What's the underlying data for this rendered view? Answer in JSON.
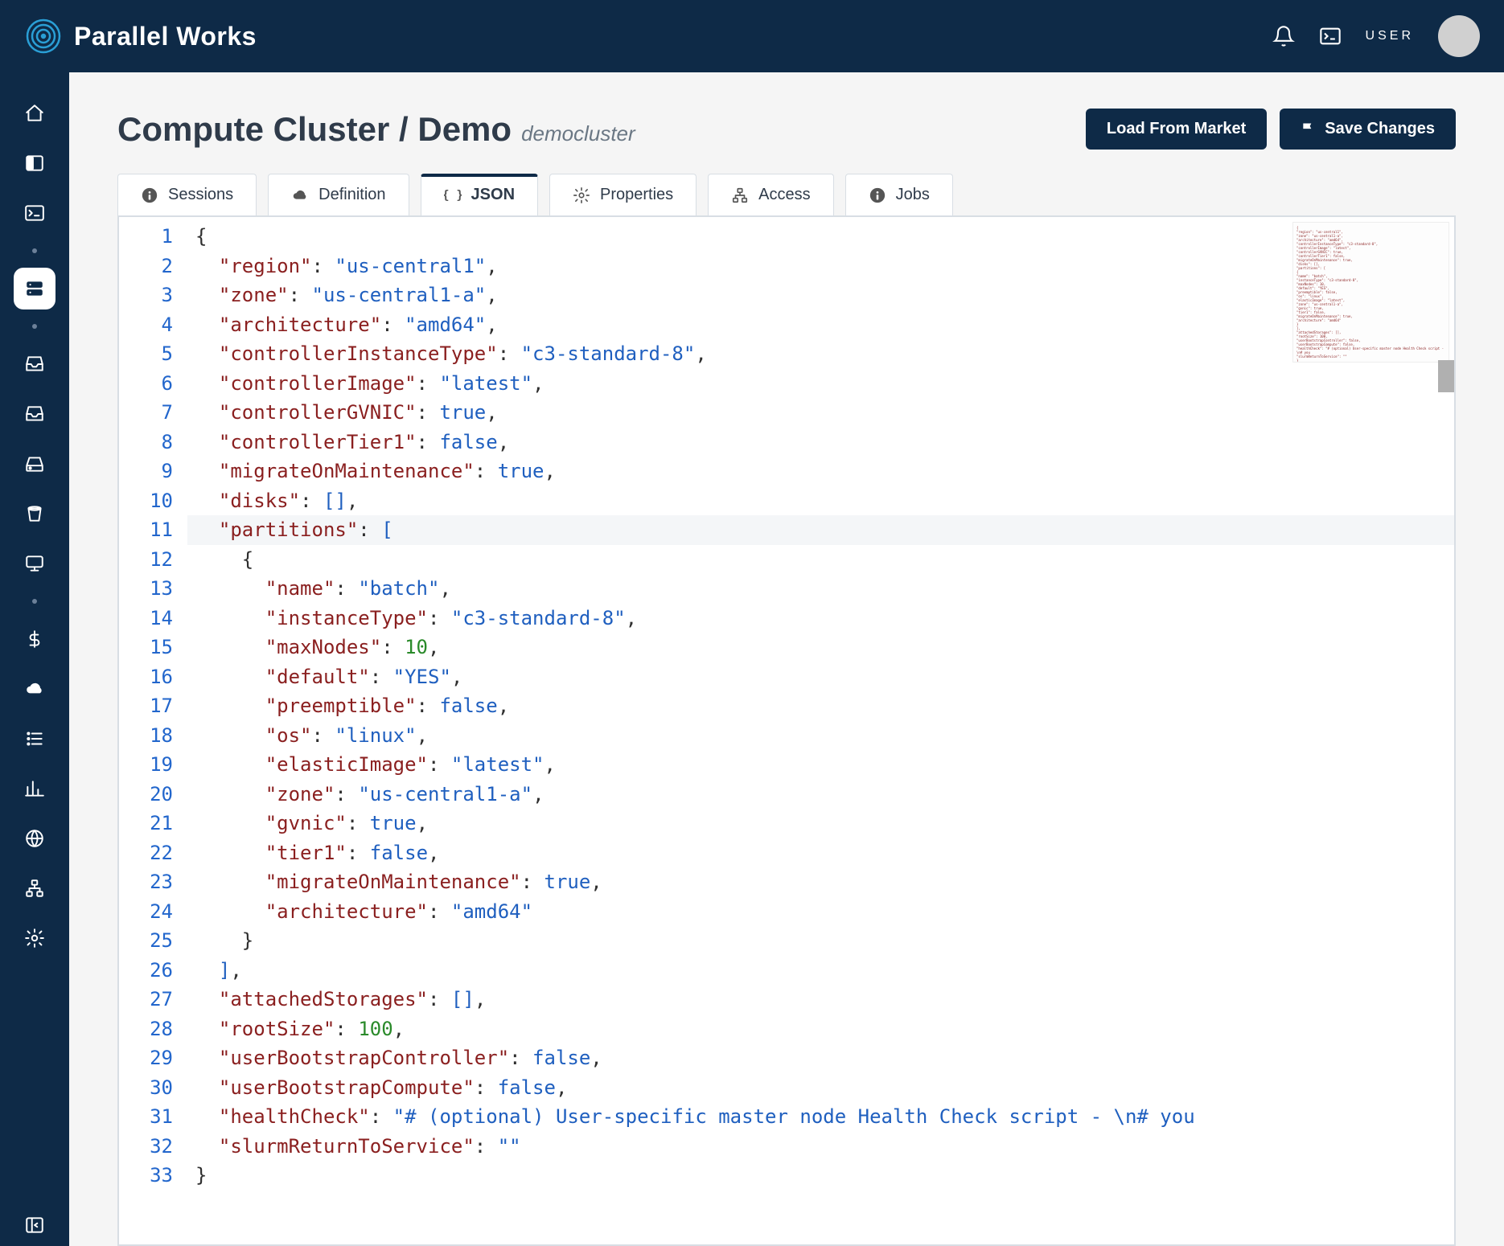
{
  "brand": "Parallel Works",
  "user_label": "USER",
  "page": {
    "title": "Compute Cluster / Demo",
    "subtitle": "democluster"
  },
  "actions": {
    "load_from_market": "Load From Market",
    "save_changes": "Save Changes"
  },
  "tabs": [
    {
      "label": "Sessions",
      "icon": "info"
    },
    {
      "label": "Definition",
      "icon": "cloud"
    },
    {
      "label": "JSON",
      "icon": "braces",
      "active": true
    },
    {
      "label": "Properties",
      "icon": "gear"
    },
    {
      "label": "Access",
      "icon": "hierarchy"
    },
    {
      "label": "Jobs",
      "icon": "info"
    }
  ],
  "sidebar": {
    "items": [
      {
        "name": "home",
        "icon": "home"
      },
      {
        "name": "panel",
        "icon": "panel"
      },
      {
        "name": "terminal",
        "icon": "terminal"
      }
    ],
    "items2": [
      {
        "name": "servers",
        "icon": "server",
        "active": true
      }
    ],
    "items3": [
      {
        "name": "inbox",
        "icon": "inbox"
      },
      {
        "name": "inbox2",
        "icon": "inbox"
      },
      {
        "name": "drive",
        "icon": "drive"
      },
      {
        "name": "bucket",
        "icon": "bucket"
      },
      {
        "name": "monitor",
        "icon": "monitor"
      }
    ],
    "items4": [
      {
        "name": "billing",
        "icon": "dollar"
      },
      {
        "name": "cloud",
        "icon": "cloud-solid"
      },
      {
        "name": "list",
        "icon": "list"
      },
      {
        "name": "chart",
        "icon": "chart"
      },
      {
        "name": "globe",
        "icon": "globe"
      },
      {
        "name": "hierarchy",
        "icon": "hierarchy"
      },
      {
        "name": "settings",
        "icon": "gears"
      }
    ],
    "footer": [
      {
        "name": "collapse",
        "icon": "collapse"
      }
    ]
  },
  "code": {
    "lines": [
      {
        "n": 1,
        "tokens": [
          [
            "brace",
            "{"
          ]
        ]
      },
      {
        "n": 2,
        "indent": 1,
        "tokens": [
          [
            "key",
            "\"region\""
          ],
          [
            "punc",
            ": "
          ],
          [
            "str",
            "\"us-central1\""
          ],
          [
            "comma",
            ","
          ]
        ]
      },
      {
        "n": 3,
        "indent": 1,
        "tokens": [
          [
            "key",
            "\"zone\""
          ],
          [
            "punc",
            ": "
          ],
          [
            "str",
            "\"us-central1-a\""
          ],
          [
            "comma",
            ","
          ]
        ]
      },
      {
        "n": 4,
        "indent": 1,
        "tokens": [
          [
            "key",
            "\"architecture\""
          ],
          [
            "punc",
            ": "
          ],
          [
            "str",
            "\"amd64\""
          ],
          [
            "comma",
            ","
          ]
        ]
      },
      {
        "n": 5,
        "indent": 1,
        "tokens": [
          [
            "key",
            "\"controllerInstanceType\""
          ],
          [
            "punc",
            ": "
          ],
          [
            "str",
            "\"c3-standard-8\""
          ],
          [
            "comma",
            ","
          ]
        ]
      },
      {
        "n": 6,
        "indent": 1,
        "tokens": [
          [
            "key",
            "\"controllerImage\""
          ],
          [
            "punc",
            ": "
          ],
          [
            "str",
            "\"latest\""
          ],
          [
            "comma",
            ","
          ]
        ]
      },
      {
        "n": 7,
        "indent": 1,
        "tokens": [
          [
            "key",
            "\"controllerGVNIC\""
          ],
          [
            "punc",
            ": "
          ],
          [
            "bool",
            "true"
          ],
          [
            "comma",
            ","
          ]
        ]
      },
      {
        "n": 8,
        "indent": 1,
        "tokens": [
          [
            "key",
            "\"controllerTier1\""
          ],
          [
            "punc",
            ": "
          ],
          [
            "bool",
            "false"
          ],
          [
            "comma",
            ","
          ]
        ]
      },
      {
        "n": 9,
        "indent": 1,
        "tokens": [
          [
            "key",
            "\"migrateOnMaintenance\""
          ],
          [
            "punc",
            ": "
          ],
          [
            "bool",
            "true"
          ],
          [
            "comma",
            ","
          ]
        ]
      },
      {
        "n": 10,
        "indent": 1,
        "tokens": [
          [
            "key",
            "\"disks\""
          ],
          [
            "punc",
            ": "
          ],
          [
            "bracket",
            "[]"
          ],
          [
            "comma",
            ","
          ]
        ]
      },
      {
        "n": 11,
        "indent": 1,
        "hl": true,
        "tokens": [
          [
            "key",
            "\"partitions\""
          ],
          [
            "punc",
            ": "
          ],
          [
            "bracket",
            "["
          ]
        ]
      },
      {
        "n": 12,
        "indent": 2,
        "tokens": [
          [
            "brace",
            "{"
          ]
        ]
      },
      {
        "n": 13,
        "indent": 3,
        "tokens": [
          [
            "key",
            "\"name\""
          ],
          [
            "punc",
            ": "
          ],
          [
            "str",
            "\"batch\""
          ],
          [
            "comma",
            ","
          ]
        ]
      },
      {
        "n": 14,
        "indent": 3,
        "tokens": [
          [
            "key",
            "\"instanceType\""
          ],
          [
            "punc",
            ": "
          ],
          [
            "str",
            "\"c3-standard-8\""
          ],
          [
            "comma",
            ","
          ]
        ]
      },
      {
        "n": 15,
        "indent": 3,
        "tokens": [
          [
            "key",
            "\"maxNodes\""
          ],
          [
            "punc",
            ": "
          ],
          [
            "num",
            "10"
          ],
          [
            "comma",
            ","
          ]
        ]
      },
      {
        "n": 16,
        "indent": 3,
        "tokens": [
          [
            "key",
            "\"default\""
          ],
          [
            "punc",
            ": "
          ],
          [
            "str",
            "\"YES\""
          ],
          [
            "comma",
            ","
          ]
        ]
      },
      {
        "n": 17,
        "indent": 3,
        "tokens": [
          [
            "key",
            "\"preemptible\""
          ],
          [
            "punc",
            ": "
          ],
          [
            "bool",
            "false"
          ],
          [
            "comma",
            ","
          ]
        ]
      },
      {
        "n": 18,
        "indent": 3,
        "tokens": [
          [
            "key",
            "\"os\""
          ],
          [
            "punc",
            ": "
          ],
          [
            "str",
            "\"linux\""
          ],
          [
            "comma",
            ","
          ]
        ]
      },
      {
        "n": 19,
        "indent": 3,
        "tokens": [
          [
            "key",
            "\"elasticImage\""
          ],
          [
            "punc",
            ": "
          ],
          [
            "str",
            "\"latest\""
          ],
          [
            "comma",
            ","
          ]
        ]
      },
      {
        "n": 20,
        "indent": 3,
        "tokens": [
          [
            "key",
            "\"zone\""
          ],
          [
            "punc",
            ": "
          ],
          [
            "str",
            "\"us-central1-a\""
          ],
          [
            "comma",
            ","
          ]
        ]
      },
      {
        "n": 21,
        "indent": 3,
        "tokens": [
          [
            "key",
            "\"gvnic\""
          ],
          [
            "punc",
            ": "
          ],
          [
            "bool",
            "true"
          ],
          [
            "comma",
            ","
          ]
        ]
      },
      {
        "n": 22,
        "indent": 3,
        "tokens": [
          [
            "key",
            "\"tier1\""
          ],
          [
            "punc",
            ": "
          ],
          [
            "bool",
            "false"
          ],
          [
            "comma",
            ","
          ]
        ]
      },
      {
        "n": 23,
        "indent": 3,
        "tokens": [
          [
            "key",
            "\"migrateOnMaintenance\""
          ],
          [
            "punc",
            ": "
          ],
          [
            "bool",
            "true"
          ],
          [
            "comma",
            ","
          ]
        ]
      },
      {
        "n": 24,
        "indent": 3,
        "tokens": [
          [
            "key",
            "\"architecture\""
          ],
          [
            "punc",
            ": "
          ],
          [
            "str",
            "\"amd64\""
          ]
        ]
      },
      {
        "n": 25,
        "indent": 2,
        "tokens": [
          [
            "brace",
            "}"
          ]
        ]
      },
      {
        "n": 26,
        "indent": 1,
        "tokens": [
          [
            "bracket",
            "]"
          ],
          [
            "comma",
            ","
          ]
        ]
      },
      {
        "n": 27,
        "indent": 1,
        "tokens": [
          [
            "key",
            "\"attachedStorages\""
          ],
          [
            "punc",
            ": "
          ],
          [
            "bracket",
            "[]"
          ],
          [
            "comma",
            ","
          ]
        ]
      },
      {
        "n": 28,
        "indent": 1,
        "tokens": [
          [
            "key",
            "\"rootSize\""
          ],
          [
            "punc",
            ": "
          ],
          [
            "num",
            "100"
          ],
          [
            "comma",
            ","
          ]
        ]
      },
      {
        "n": 29,
        "indent": 1,
        "tokens": [
          [
            "key",
            "\"userBootstrapController\""
          ],
          [
            "punc",
            ": "
          ],
          [
            "bool",
            "false"
          ],
          [
            "comma",
            ","
          ]
        ]
      },
      {
        "n": 30,
        "indent": 1,
        "tokens": [
          [
            "key",
            "\"userBootstrapCompute\""
          ],
          [
            "punc",
            ": "
          ],
          [
            "bool",
            "false"
          ],
          [
            "comma",
            ","
          ]
        ]
      },
      {
        "n": 31,
        "indent": 1,
        "tokens": [
          [
            "key",
            "\"healthCheck\""
          ],
          [
            "punc",
            ": "
          ],
          [
            "str",
            "\"# (optional) User-specific master node Health Check script - \\n# you"
          ]
        ]
      },
      {
        "n": 32,
        "indent": 1,
        "tokens": [
          [
            "key",
            "\"slurmReturnToService\""
          ],
          [
            "punc",
            ": "
          ],
          [
            "str",
            "\"\""
          ]
        ]
      },
      {
        "n": 33,
        "tokens": [
          [
            "brace",
            "}"
          ]
        ]
      }
    ]
  }
}
